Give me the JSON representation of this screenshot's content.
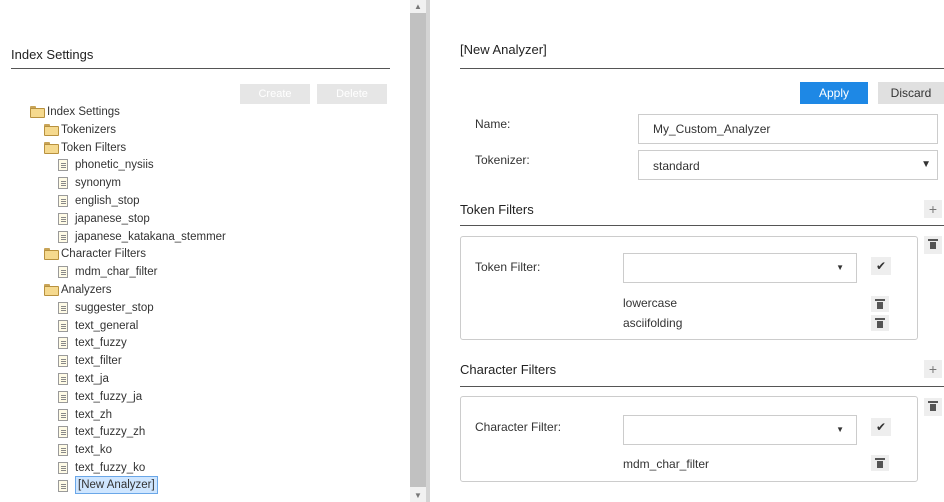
{
  "left": {
    "title": "Index Settings",
    "create_label": "Create",
    "delete_label": "Delete",
    "tree": [
      {
        "label": "Index Settings",
        "icon": "folder-open-icon",
        "level": 0
      },
      {
        "label": "Tokenizers",
        "icon": "folder-icon",
        "level": 1
      },
      {
        "label": "Token Filters",
        "icon": "folder-open-icon",
        "level": 1
      },
      {
        "label": "phonetic_nysiis",
        "icon": "document-icon",
        "level": 2
      },
      {
        "label": "synonym",
        "icon": "document-icon",
        "level": 2
      },
      {
        "label": "english_stop",
        "icon": "document-icon",
        "level": 2
      },
      {
        "label": "japanese_stop",
        "icon": "document-icon",
        "level": 2
      },
      {
        "label": "japanese_katakana_stemmer",
        "icon": "document-icon",
        "level": 2
      },
      {
        "label": "Character Filters",
        "icon": "folder-open-icon",
        "level": 1
      },
      {
        "label": "mdm_char_filter",
        "icon": "document-icon",
        "level": 2
      },
      {
        "label": "Analyzers",
        "icon": "folder-open-icon",
        "level": 1
      },
      {
        "label": "suggester_stop",
        "icon": "document-icon",
        "level": 2
      },
      {
        "label": "text_general",
        "icon": "document-icon",
        "level": 2
      },
      {
        "label": "text_fuzzy",
        "icon": "document-icon",
        "level": 2
      },
      {
        "label": "text_filter",
        "icon": "document-icon",
        "level": 2
      },
      {
        "label": "text_ja",
        "icon": "document-icon",
        "level": 2
      },
      {
        "label": "text_fuzzy_ja",
        "icon": "document-icon",
        "level": 2
      },
      {
        "label": "text_zh",
        "icon": "document-icon",
        "level": 2
      },
      {
        "label": "text_fuzzy_zh",
        "icon": "document-icon",
        "level": 2
      },
      {
        "label": "text_ko",
        "icon": "document-icon",
        "level": 2
      },
      {
        "label": "text_fuzzy_ko",
        "icon": "document-icon",
        "level": 2
      },
      {
        "label": "[New Analyzer]",
        "icon": "document-icon",
        "level": 2,
        "selected": true
      }
    ]
  },
  "right": {
    "title": "[New Analyzer]",
    "apply_label": "Apply",
    "discard_label": "Discard",
    "name_label": "Name:",
    "name_value": "My_Custom_Analyzer",
    "tokenizer_label": "Tokenizer:",
    "tokenizer_value": "standard",
    "token_filters": {
      "title": "Token Filters",
      "field_label": "Token Filter:",
      "items": [
        "lowercase",
        "asciifolding"
      ]
    },
    "character_filters": {
      "title": "Character Filters",
      "field_label": "Character Filter:",
      "items": [
        "mdm_char_filter"
      ]
    }
  },
  "colors": {
    "accent": "#1e88e5",
    "selection": "#cfe6ff"
  }
}
